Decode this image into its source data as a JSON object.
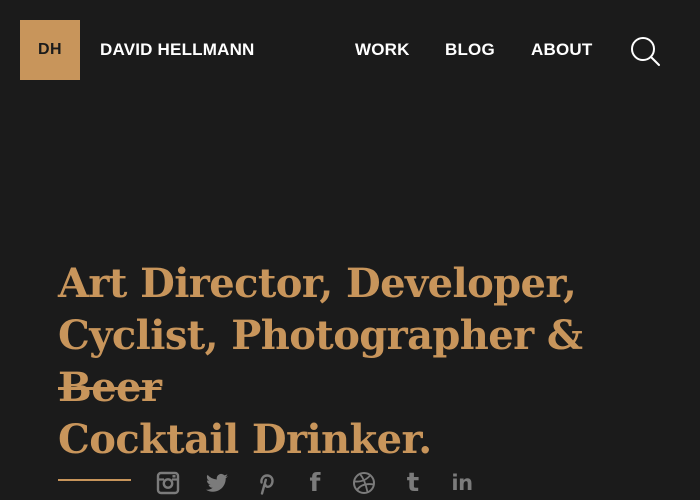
{
  "header": {
    "logo_initials": "DH",
    "site_name": "DAVID HELLMANN",
    "nav": {
      "work": "WORK",
      "blog": "BLOG",
      "about": "ABOUT"
    },
    "search_icon": "search-icon"
  },
  "hero": {
    "line1": "Art Director, Developer,",
    "line2_prefix": "Cyclist, Photographer & ",
    "line2_struck": "Beer",
    "line3": "Cocktail Drinker."
  },
  "social": {
    "icons": [
      "instagram-icon",
      "twitter-icon",
      "pinterest-icon",
      "facebook-icon",
      "dribbble-icon",
      "tumblr-icon",
      "linkedin-icon"
    ],
    "facebook_glyph": "f",
    "tumblr_glyph": "t",
    "linkedin_glyph": "in"
  },
  "colors": {
    "background": "#1b1b1b",
    "accent": "#c8955b",
    "nav_text": "#ffffff",
    "icon_gray": "#7b7b7b"
  }
}
